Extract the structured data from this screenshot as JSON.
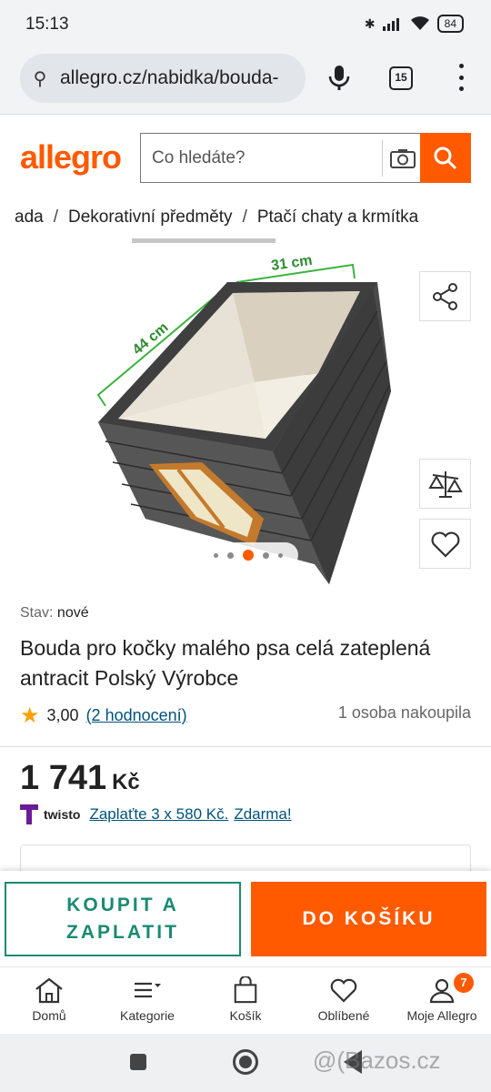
{
  "status_bar": {
    "time": "15:13",
    "battery": "84"
  },
  "browser": {
    "url": "allegro.cz/nabidka/bouda-",
    "tab_count": "15"
  },
  "header": {
    "logo": "allegro",
    "search_placeholder": "Co hledáte?"
  },
  "breadcrumbs": [
    "ada",
    "Dekorativní předměty",
    "Ptačí chaty a krmítka"
  ],
  "gallery": {
    "dim_width": "31 cm",
    "dim_length": "44 cm",
    "current_image": 3,
    "image_count": 5
  },
  "product": {
    "condition_label": "Stav:",
    "condition_value": "nové",
    "title": "Bouda pro kočky malého psa celá zateplená antracit Polský Výrobce",
    "rating_value": "3,00",
    "rating_count": "(2 hodnocení)",
    "bought": "1 osoba nakoupila",
    "price": "1 741",
    "currency": "Kč"
  },
  "twisto": {
    "brand": "twisto",
    "offer": "Zaplaťte 3 x 580 Kč.",
    "free": "Zdarma!"
  },
  "actions": {
    "buy_now": "KOUPIT A ZAPLATIT",
    "add_to_cart": "DO KOŠÍKU"
  },
  "bottom_nav": [
    {
      "label": "Domů",
      "icon": "home-icon"
    },
    {
      "label": "Kategorie",
      "icon": "menu-icon"
    },
    {
      "label": "Košík",
      "icon": "bag-icon"
    },
    {
      "label": "Oblíbené",
      "icon": "heart-icon"
    },
    {
      "label": "Moje Allegro",
      "icon": "user-icon",
      "badge": "7"
    }
  ],
  "watermark": "@(Bazos.cz",
  "colors": {
    "brand": "#ff5a00",
    "buy_outline": "#1a8a72",
    "link": "#00527a"
  }
}
